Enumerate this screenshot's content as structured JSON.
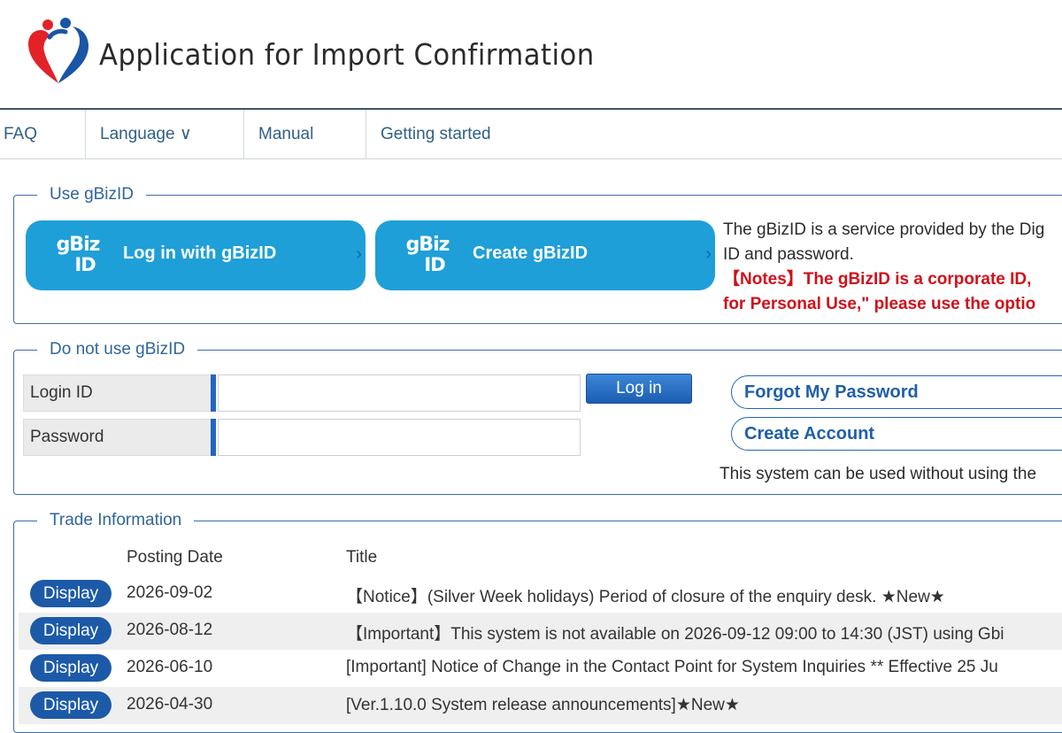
{
  "header": {
    "title": "Application for Import Confirmation",
    "logo_icon": "heart-people-logo"
  },
  "nav": {
    "items": [
      {
        "label": "FAQ"
      },
      {
        "label": "Language ∨"
      },
      {
        "label": "Manual"
      },
      {
        "label": "Getting started"
      }
    ]
  },
  "gbiz_section": {
    "legend": "Use gBizID",
    "logo_line1": "gBiz",
    "logo_line2": "ID",
    "login_button": "Log in with gBizID",
    "create_button": "Create gBizID",
    "chevron": "›",
    "description_line1": "The gBizID is a service provided by the Dig",
    "description_line2": "ID and password.",
    "notes_line1": "【Notes】The gBizID is a corporate ID,",
    "notes_line2": "for Personal Use,\" please use the optio"
  },
  "login_section": {
    "legend": "Do not use gBizID",
    "login_id_label": "Login ID",
    "login_id_value": "",
    "password_label": "Password",
    "password_value": "",
    "login_button": "Log in",
    "forgot_password": "Forgot My Password",
    "create_account": "Create Account",
    "note": "This system can be used without using the"
  },
  "trade_section": {
    "legend": "Trade Information",
    "columns": {
      "date": "Posting Date",
      "title": "Title"
    },
    "display_label": "Display",
    "rows": [
      {
        "date": "2026-09-02",
        "title": "【Notice】(Silver Week holidays) Period of closure of the enquiry desk. ★New★"
      },
      {
        "date": "2026-08-12",
        "title": "【Important】This system is not available on 2026-09-12 09:00 to 14:30 (JST) using Gbi"
      },
      {
        "date": "2026-06-10",
        "title": "[Important] Notice of Change in the Contact Point for System Inquiries ** Effective 25 Ju"
      },
      {
        "date": "2026-04-30",
        "title": "[Ver.1.10.0 System release announcements]★New★"
      }
    ]
  },
  "colors": {
    "accent_blue": "#1f9fd7",
    "nav_text": "#2f5f86",
    "button_blue": "#1c5aa8",
    "notes_red": "#d0101a"
  }
}
